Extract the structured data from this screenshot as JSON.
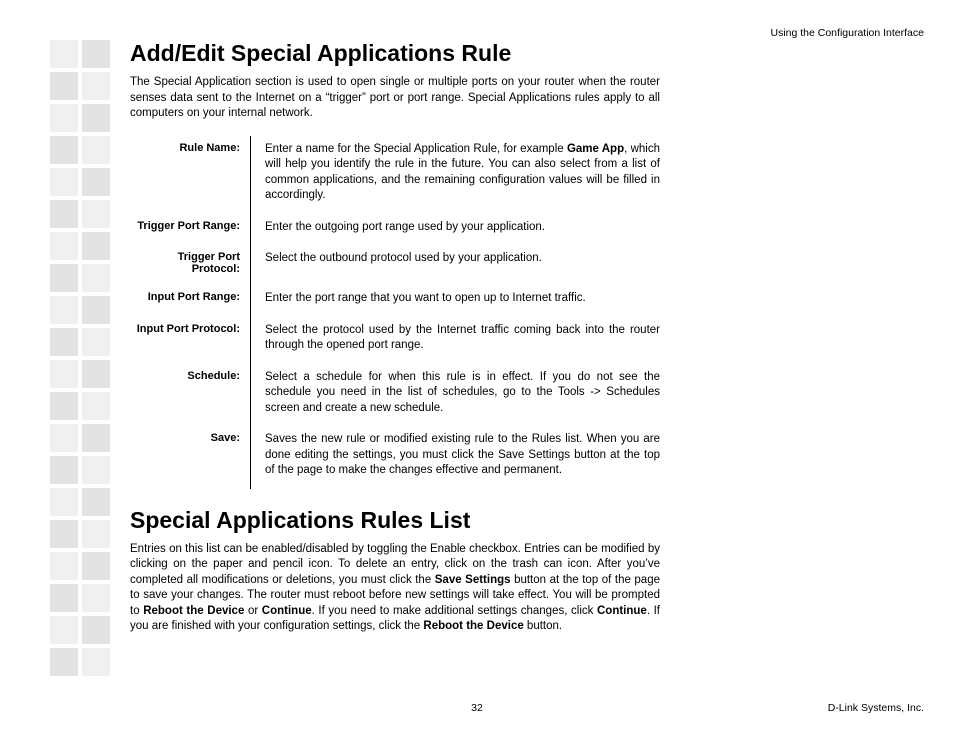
{
  "header": {
    "right": "Using the Configuration Interface"
  },
  "section1": {
    "title": "Add/Edit Special Applications Rule",
    "intro": "The Special Application section is used to open single or multiple ports on your router when the router senses data sent to the Internet on a “trigger” port or port range. Special Applications rules apply to all computers on your internal network.",
    "defs": [
      {
        "label": "Rule Name:",
        "pre": "Enter a name for the Special Application Rule, for example ",
        "bold": "Game App",
        "post": ", which will help you identify the rule in the future. You can also select from a list of common applications, and the remaining configuration values will be filled in accordingly."
      },
      {
        "label": "Trigger Port Range:",
        "text": "Enter the outgoing port range used by your application."
      },
      {
        "label": "Trigger Port Protocol:",
        "text": "Select the outbound protocol used by your application."
      },
      {
        "label": "Input Port Range:",
        "text": "Enter the port range that you want to open up to Internet traffic."
      },
      {
        "label": "Input Port Protocol:",
        "text": "Select the protocol used by the Internet traffic coming back into the router through the opened port range."
      },
      {
        "label": "Schedule:",
        "text": "Select a schedule for when this rule is in effect. If you do not see the schedule you need in the list of schedules, go to the Tools -> Schedules screen and create a new schedule."
      },
      {
        "label": "Save:",
        "text": "Saves the new rule or modified existing rule to the Rules list. When you are done editing the settings, you must click the Save Settings button at the top of the page to make the changes effective and permanent."
      }
    ]
  },
  "section2": {
    "title": "Special Applications Rules List",
    "runs": [
      {
        "t": "Entries on this list can be enabled/disabled by toggling the Enable checkbox. Entries can be modified by clicking on the paper and pencil icon. To delete an entry, click on the trash can icon. After you’ve completed all modifications or deletions, you must click the "
      },
      {
        "t": "Save Settings",
        "b": true
      },
      {
        "t": " button at the top of the page to save your changes. The router must reboot before new settings will take effect. You will be prompted to "
      },
      {
        "t": "Reboot the Device",
        "b": true
      },
      {
        "t": " or "
      },
      {
        "t": "Continue",
        "b": true
      },
      {
        "t": ". If you need to make additional settings changes, click "
      },
      {
        "t": "Continue",
        "b": true
      },
      {
        "t": ". If you are finished with your configuration settings, click the "
      },
      {
        "t": "Reboot the Device",
        "b": true
      },
      {
        "t": " button."
      }
    ]
  },
  "footer": {
    "page": "32",
    "company": "D-Link Systems, Inc."
  }
}
